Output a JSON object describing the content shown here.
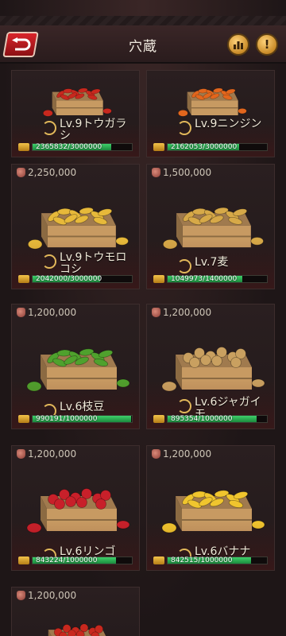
{
  "header": {
    "title": "穴蔵"
  },
  "cards": [
    {
      "price": "",
      "name": "Lv.9トウガラシ",
      "progress_text": "2365832/3000000",
      "progress": 0.789,
      "crop": "chili",
      "color": "#c8281e"
    },
    {
      "price": "",
      "name": "Lv.9ニンジン",
      "progress_text": "2162053/3000000",
      "progress": 0.721,
      "crop": "carrot",
      "color": "#e2661d"
    },
    {
      "price": "2,250,000",
      "name": "Lv.9トウモロコシ",
      "progress_text": "2042000/3000000",
      "progress": 0.681,
      "crop": "corn",
      "color": "#e7b93a"
    },
    {
      "price": "1,500,000",
      "name": "Lv.7麦",
      "progress_text": "1049973/1400000",
      "progress": 0.75,
      "crop": "wheat",
      "color": "#d7a948"
    },
    {
      "price": "1,200,000",
      "name": "Lv.6枝豆",
      "progress_text": "990191/1000000",
      "progress": 0.99,
      "crop": "peas",
      "color": "#4fa12d"
    },
    {
      "price": "1,200,000",
      "name": "Lv.6ジャガイモ",
      "progress_text": "895354/1000000",
      "progress": 0.895,
      "crop": "potato",
      "color": "#c9a060"
    },
    {
      "price": "1,200,000",
      "name": "Lv.6リンゴ",
      "progress_text": "843224/1000000",
      "progress": 0.843,
      "crop": "apple",
      "color": "#c8202a"
    },
    {
      "price": "1,200,000",
      "name": "Lv.6バナナ",
      "progress_text": "842515/1000000",
      "progress": 0.843,
      "crop": "banana",
      "color": "#f0c52e"
    },
    {
      "price": "1,200,000",
      "name": "",
      "progress_text": "",
      "progress": 0,
      "crop": "tomato",
      "color": "#c8281e"
    }
  ]
}
